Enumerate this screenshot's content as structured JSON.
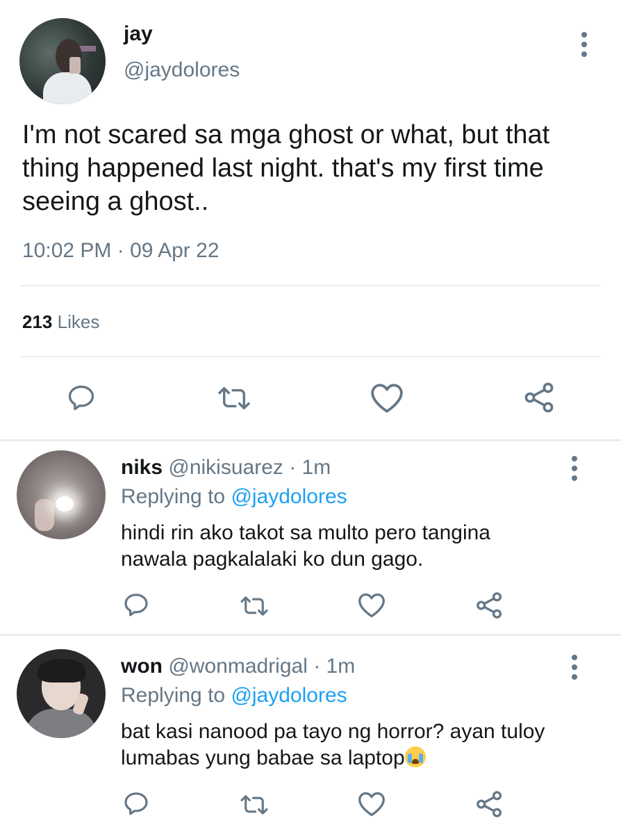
{
  "main_tweet": {
    "display_name": "jay",
    "handle": "@jaydolores",
    "text": "I'm not scared sa mga ghost or what, but that thing happened last night. that's my first time seeing a ghost..",
    "timestamp": "10:02 PM · 09 Apr 22",
    "likes_count": "213",
    "likes_label": "Likes"
  },
  "actions": {
    "reply_icon": "speech-bubble-icon",
    "retweet_icon": "retweet-icon",
    "like_icon": "heart-icon",
    "share_icon": "share-icon"
  },
  "colors": {
    "text": "#14171a",
    "secondary": "#657786",
    "mention": "#1da1f2",
    "divider": "#e6ecf0"
  },
  "replies": [
    {
      "display_name": "niks",
      "handle": "@nikisuarez",
      "time": "· 1m",
      "replying_label": "Replying to",
      "replying_to": "@jaydolores",
      "text_line1": "hindi rin ako takot sa multo pero tangina",
      "text_line2": "nawala pagkalalaki ko dun gago."
    },
    {
      "display_name": "won",
      "handle": "@wonmadrigal",
      "time": "· 1m",
      "replying_label": "Replying to",
      "replying_to": "@jaydolores",
      "text_line1": "bat kasi nanood pa tayo ng horror? ayan tuloy",
      "text_line2": "lumabas yung babae sa laptop",
      "emoji": "loudly-crying-face-emoji"
    }
  ]
}
